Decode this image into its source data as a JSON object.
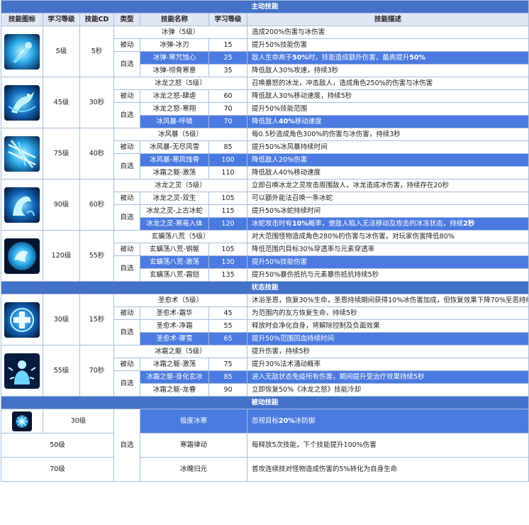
{
  "sections": {
    "active": "主动技能",
    "status": "状态技能",
    "passive": "被动技能"
  },
  "headers": {
    "icon": "技能图标",
    "level": "学习等级",
    "cd": "技能CD",
    "type": "类型",
    "name": "技能名称",
    "learn_level": "学习等级",
    "desc": "技能描述"
  },
  "types": {
    "passive": "被动",
    "optional": "自选"
  },
  "colors": {
    "section": "#4472c8",
    "header": "#dfe7f3",
    "highlight": "#4b7be0",
    "border": "#a7bedc"
  },
  "active": [
    {
      "level": "5级",
      "cd": "5秒",
      "icon": "ice-shard-icon",
      "main": {
        "name": "冰弹（5级）",
        "desc": "造成200%伤害与冰伤害"
      },
      "passive": {
        "name": "冰弹-冰刃",
        "lvl": "15",
        "desc": "提升50%技能伤害"
      },
      "opts": [
        {
          "name": "冰弹-寒咒蚀心",
          "lvl": "25",
          "desc_a": "敌人生命高于",
          "desc_b": "50%",
          "desc_c": "时，技能造成额外伤害，最高提升",
          "desc_d": "50%"
        },
        {
          "name": "冰弹-彻骨寒意",
          "lvl": "35",
          "desc": "降低敌人30%攻速，持续3秒"
        }
      ]
    },
    {
      "level": "45级",
      "cd": "30秒",
      "icon": "ice-dragon-icon",
      "main": {
        "name": "冰龙之怒（5级）",
        "desc": "召唤暴怒的冰龙，冲击敌人，造成角色250%的伤害与冰伤害"
      },
      "passive": {
        "name": "冰龙之怒-肆虐",
        "lvl": "60",
        "desc": "降低敌人30%移动速度，持续5秒"
      },
      "opts": [
        {
          "name": "冰龙之怒-寒翔",
          "lvl": "70",
          "desc": "提升50%技能范围"
        },
        {
          "name": "冰风暴-呼啸",
          "lvl": "70",
          "desc_a": "降低敌人",
          "desc_b": "40%",
          "desc_c": "移动速度"
        }
      ]
    },
    {
      "level": "75级",
      "cd": "40秒",
      "icon": "ice-storm-icon",
      "main": {
        "name": "冰风暴（5级）",
        "desc": "每0.5秒造成角色300%的伤害与冰伤害，持续3秒"
      },
      "passive": {
        "name": "冰风暴-无尽风雪",
        "lvl": "85",
        "desc": "提升50%冰风暴持续时间"
      },
      "opts": [
        {
          "name": "冰风暴-寒风蚀骨",
          "lvl": "100",
          "desc": "降低敌人20%伤害"
        },
        {
          "name": "冰霜之躯-激荡",
          "lvl": "110",
          "desc": "降低敌人40%移动速度"
        }
      ]
    },
    {
      "level": "90级",
      "cd": "60秒",
      "icon": "ice-spirit-icon",
      "main": {
        "name": "冰龙之灵（5级）",
        "desc": "立即召唤冰龙之灵攻击周围敌人，冰龙造成冰伤害，持续存在20秒"
      },
      "passive": {
        "name": "冰龙之灵-双生",
        "lvl": "105",
        "desc": "可以额外能法召唤一条冰蛇"
      },
      "opts": [
        {
          "name": "冰龙之灵-上古冰蛇",
          "lvl": "115",
          "desc": "提升50%冰蛇持续时间"
        },
        {
          "name": "冰龙之灵-寒毒入体",
          "lvl": "120",
          "desc_a": "冰蛇攻击时有",
          "desc_b": "10%",
          "desc_c": "概率，使敌人陷入无法移动及攻击的冰冻状态，持续",
          "desc_d": "2秒"
        }
      ]
    },
    {
      "level": "120级",
      "cd": "55秒",
      "icon": "mystic-sphere-icon",
      "main": {
        "name": "玄螭荡八荒（5级）",
        "desc": "对大范围怪物造成角色280%的伤害与冰伤害，对玩家伤害降低80%"
      },
      "passive": {
        "name": "玄螭荡八荒-钢躯",
        "lvl": "105",
        "desc": "降低范围内目标30%穿透率与元素穿透率"
      },
      "opts": [
        {
          "name": "玄螭荡八荒-激荡",
          "lvl": "130",
          "desc": "提升50%技能伤害"
        },
        {
          "name": "玄螭荡八荒-霜铠",
          "lvl": "135",
          "desc": "提升50%暴伤抵抗与元素暴伤抵抗持续5秒"
        }
      ]
    }
  ],
  "status": [
    {
      "level": "30级",
      "cd": "15秒",
      "icon": "healing-cross-icon",
      "main": {
        "name": "圣愈术（5级）",
        "desc": "沐浴圣恩，恢复30%生命，圣恩持续期间获得10%冰伤害加成，但恢复效果下降70%至恶持续30秒"
      },
      "passive": {
        "name": "圣愈术-霜华",
        "lvl": "45",
        "desc": "为范围内的友方恢复生命，持续5秒"
      },
      "opts": [
        {
          "name": "圣愈术-净霜",
          "lvl": "55",
          "desc": "释放时会净化自身，将解除控制及负面效果"
        },
        {
          "name": "圣愈术-骤雪",
          "lvl": "65",
          "desc": "提升50%范围回血持续时间"
        }
      ]
    },
    {
      "level": "55级",
      "cd": "70秒",
      "icon": "frost-body-icon",
      "main": {
        "name": "冰霜之躯（5级）",
        "desc": "提升伤害，持续5秒"
      },
      "passive": {
        "name": "冰霜之躯-激荡",
        "lvl": "75",
        "desc": "提升30%法术涌动概率"
      },
      "opts": [
        {
          "name": "冰霜之躯-身化玄冰",
          "lvl": "85",
          "desc": "进入无敌状态免疫所有伤害，期间提升受治疗效果持续5秒"
        },
        {
          "name": "冰霜之躯-龙眷",
          "lvl": "90",
          "desc": "立即恢复50%《冰龙之怒》技能冷却"
        }
      ]
    }
  ],
  "passive_skills": [
    {
      "level": "30级",
      "name": "极度冰寒",
      "desc_a": "忽视目标",
      "desc_b": "20%",
      "desc_c": "冰防御",
      "icon": "frost-orb-icon"
    },
    {
      "level": "50级",
      "name": "寒霜律动",
      "desc": "每释放5次技能，下个技能提升100%伤害"
    },
    {
      "level": "70级",
      "name": "冰魄归元",
      "desc": "普攻连续技对怪物造成伤害的5%转化为自身生命"
    }
  ]
}
